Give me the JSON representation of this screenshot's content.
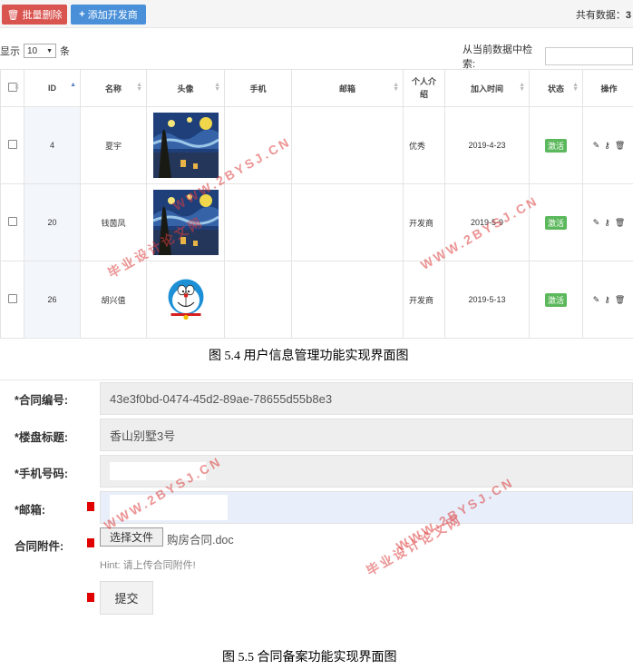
{
  "toolbar": {
    "batch_delete": "批量删除",
    "add_developer": "添加开发商",
    "total_label": "共有数据：",
    "total_count": "3"
  },
  "length_menu": {
    "prefix": "显示",
    "value": "10",
    "suffix": "条"
  },
  "search": {
    "label": "从当前数据中检索:",
    "placeholder": ""
  },
  "table": {
    "headers": [
      "ID",
      "名称",
      "头像",
      "手机",
      "邮箱",
      "个人介绍",
      "加入时间",
      "状态",
      "操作"
    ],
    "rows": [
      {
        "id": "4",
        "name": "夏宇",
        "phone": "",
        "email": "",
        "intro": "优秀",
        "joined": "2019-4-23",
        "status": "激活",
        "avatar": "starry-night-image"
      },
      {
        "id": "20",
        "name": "钱茵凤",
        "phone": "",
        "email": "",
        "intro": "开发商",
        "joined": "2019-5-9",
        "status": "激活",
        "avatar": "starry-night-image"
      },
      {
        "id": "26",
        "name": "胡兴值",
        "phone": "",
        "email": "",
        "intro": "开发商",
        "joined": "2019-5-13",
        "status": "激活",
        "avatar": "doraemon-image"
      }
    ]
  },
  "captions": {
    "fig1": "图 5.4 用户信息管理功能实现界面图",
    "fig2": "图 5.5  合同备案功能实现界面图"
  },
  "form": {
    "contract_no_label": "*合同编号:",
    "contract_no_value": "43e3f0bd-0474-45d2-89ae-78655d55b8e3",
    "property_title_label": "*楼盘标题:",
    "property_title_value": "香山别墅3号",
    "phone_label": "*手机号码:",
    "phone_value": "",
    "email_label": "*邮箱:",
    "email_value": "",
    "attachment_label": "合同附件:",
    "choose_file": "选择文件",
    "file_name": "购房合同.doc",
    "hint": "Hint: 请上传合同附件!",
    "submit": "提交"
  },
  "watermarks": {
    "site": "WWW.2BYSJ.CN",
    "text": "毕业设计论文网"
  },
  "colors": {
    "danger": "#d9534f",
    "primary": "#4a90d9",
    "success": "#5cb85c",
    "watermark": "#dc3c3c"
  }
}
